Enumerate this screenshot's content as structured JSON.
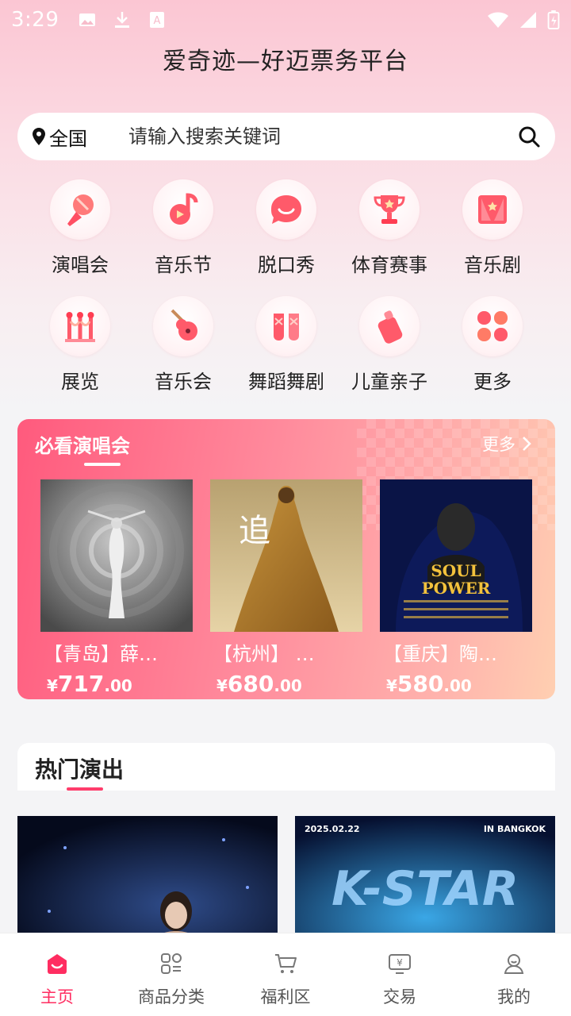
{
  "status_bar": {
    "time": "3:29"
  },
  "header": {
    "title": "爱奇迹—好迈票务平台"
  },
  "search": {
    "location": "全国",
    "placeholder": "请输入搜索关键词"
  },
  "categories": [
    {
      "label": "演唱会",
      "icon": "microphone-icon"
    },
    {
      "label": "音乐节",
      "icon": "music-note-icon"
    },
    {
      "label": "脱口秀",
      "icon": "smile-bubble-icon"
    },
    {
      "label": "体育赛事",
      "icon": "trophy-icon"
    },
    {
      "label": "音乐剧",
      "icon": "curtain-icon"
    },
    {
      "label": "展览",
      "icon": "exhibit-rope-icon"
    },
    {
      "label": "音乐会",
      "icon": "guitar-icon"
    },
    {
      "label": "舞蹈舞剧",
      "icon": "ballet-shoes-icon"
    },
    {
      "label": "儿童亲子",
      "icon": "baby-bottle-icon"
    },
    {
      "label": "更多",
      "icon": "more-grid-icon"
    }
  ],
  "must_see": {
    "title": "必看演唱会",
    "more_label": "更多",
    "items": [
      {
        "name": "【青岛】薛…",
        "currency": "¥",
        "price_int": "717",
        "price_dec": ".00"
      },
      {
        "name": "【杭州】 …",
        "currency": "¥",
        "price_int": "680",
        "price_dec": ".00"
      },
      {
        "name": "【重庆】陶…",
        "currency": "¥",
        "price_int": "580",
        "price_dec": ".00"
      }
    ],
    "poster2_text": "追",
    "poster3_text1": "SOUL",
    "poster3_text2": "POWER",
    "poster4_date": "2025.02.22",
    "poster4_place": "IN BANGKOK",
    "poster4_title": "K-STAR"
  },
  "hot": {
    "title": "热门演出"
  },
  "bottom_nav": [
    {
      "label": "主页",
      "icon": "home-icon",
      "active": true
    },
    {
      "label": "商品分类",
      "icon": "category-icon",
      "active": false
    },
    {
      "label": "福利区",
      "icon": "cart-icon",
      "active": false
    },
    {
      "label": "交易",
      "icon": "trade-icon",
      "active": false
    },
    {
      "label": "我的",
      "icon": "profile-icon",
      "active": false
    }
  ],
  "colors": {
    "accent": "#ff2d61",
    "card_gradient_start": "#ff5a7d",
    "card_gradient_end": "#ffcfb1"
  }
}
